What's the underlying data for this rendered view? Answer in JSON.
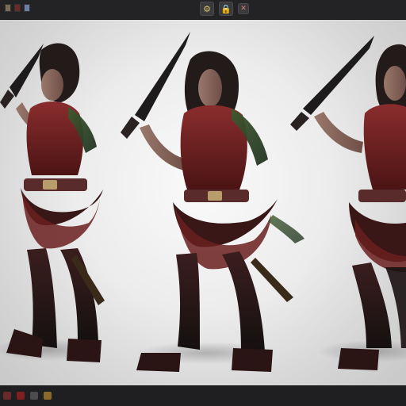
{
  "app": {
    "name": ""
  },
  "toolbar": {
    "left_icons": [
      "folder-icon",
      "brush-icon",
      "flag-icon"
    ],
    "center_buttons": [
      {
        "name": "gear-icon",
        "glyph": "⚙"
      },
      {
        "name": "lock-icon",
        "glyph": "🔒"
      },
      {
        "name": "close-icon",
        "glyph": "✕"
      }
    ]
  },
  "viewport": {
    "figures": [
      {
        "name": "character-pose-front-left"
      },
      {
        "name": "character-pose-front-center"
      },
      {
        "name": "character-pose-right"
      }
    ],
    "colors": {
      "background_center": "#fafafa",
      "background_edge": "#c8c8c8",
      "armor_red": "#7a2626",
      "armor_green": "#3f5a2f",
      "leather_dark": "#2a1b1b",
      "skin": "#8e6e63",
      "hair": "#231a1a",
      "blade": "#1d1b1b"
    }
  },
  "status_bar": {
    "icons": [
      "record-icon",
      "layers-icon",
      "palette-icon",
      "film-icon"
    ]
  }
}
